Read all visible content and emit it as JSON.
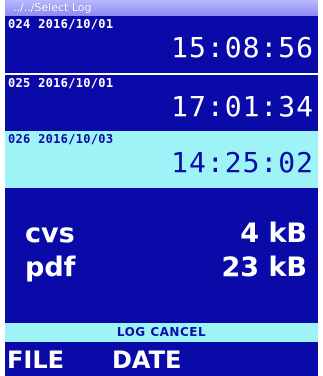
{
  "header": {
    "path": "../../Select Log"
  },
  "logs": [
    {
      "id": "024",
      "date": "2016/10/01",
      "time": "15:08:56",
      "selected": false
    },
    {
      "id": "025",
      "date": "2016/10/01",
      "time": "17:01:34",
      "selected": false
    },
    {
      "id": "026",
      "date": "2016/10/03",
      "time": "14:25:02",
      "selected": true
    }
  ],
  "file_sizes": [
    {
      "format": "cvs",
      "size": "4 kB"
    },
    {
      "format": "pdf",
      "size": "23 kB"
    }
  ],
  "action_bar": {
    "label": "LOG CANCEL"
  },
  "softkeys": {
    "left": "FILE",
    "middle": "DATE"
  },
  "colors": {
    "background": "#0a0aa8",
    "highlight": "#9df3f6",
    "text": "#ffffff"
  }
}
